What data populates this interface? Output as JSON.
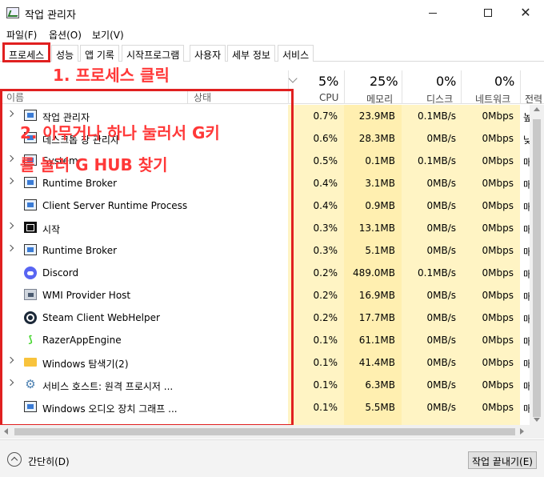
{
  "window": {
    "title": "작업 관리자"
  },
  "menu": [
    "파일(F)",
    "옵션(O)",
    "보기(V)"
  ],
  "tabs": [
    "프로세스",
    "성능",
    "앱 기록",
    "시작프로그램",
    "사용자",
    "세부 정보",
    "서비스"
  ],
  "annotations": {
    "step1": "1. 프로세스 클릭",
    "step2_line1": "2. 아무거나 하나 눌러서 G키",
    "step2_line2": "를 눌러 G HUB 찾기"
  },
  "columns": {
    "name": "이름",
    "status": "상태",
    "cpu": {
      "pct": "5%",
      "label": "CPU"
    },
    "memory": {
      "pct": "25%",
      "label": "메모리"
    },
    "disk": {
      "pct": "0%",
      "label": "디스크"
    },
    "network": {
      "pct": "0%",
      "label": "네트워크"
    },
    "power": {
      "label": "전력"
    }
  },
  "processes": [
    {
      "name": "작업 관리자",
      "expandable": true,
      "icon": "task-manager-icon",
      "cpu": "0.7%",
      "memory": "23.9MB",
      "disk": "0.1MB/s",
      "network": "0Mbps",
      "power": "높"
    },
    {
      "name": "데스크톱 창 관리자",
      "expandable": false,
      "icon": "window-icon",
      "cpu": "0.6%",
      "memory": "28.3MB",
      "disk": "0MB/s",
      "network": "0Mbps",
      "power": "낮"
    },
    {
      "name": "System",
      "expandable": true,
      "icon": "window-icon",
      "cpu": "0.5%",
      "memory": "0.1MB",
      "disk": "0.1MB/s",
      "network": "0Mbps",
      "power": "매"
    },
    {
      "name": "Runtime Broker",
      "expandable": true,
      "icon": "window-icon",
      "cpu": "0.4%",
      "memory": "3.1MB",
      "disk": "0MB/s",
      "network": "0Mbps",
      "power": "매"
    },
    {
      "name": "Client Server Runtime Process",
      "expandable": false,
      "icon": "window-icon",
      "cpu": "0.4%",
      "memory": "0.9MB",
      "disk": "0MB/s",
      "network": "0Mbps",
      "power": "매"
    },
    {
      "name": "시작",
      "expandable": true,
      "icon": "start-icon",
      "cpu": "0.3%",
      "memory": "13.1MB",
      "disk": "0MB/s",
      "network": "0Mbps",
      "power": "매"
    },
    {
      "name": "Runtime Broker",
      "expandable": true,
      "icon": "window-icon",
      "cpu": "0.3%",
      "memory": "5.1MB",
      "disk": "0MB/s",
      "network": "0Mbps",
      "power": "매"
    },
    {
      "name": "Discord",
      "expandable": false,
      "icon": "discord-icon",
      "cpu": "0.2%",
      "memory": "489.0MB",
      "disk": "0.1MB/s",
      "network": "0Mbps",
      "power": "매"
    },
    {
      "name": "WMI Provider Host",
      "expandable": false,
      "icon": "wmi-icon",
      "cpu": "0.2%",
      "memory": "16.9MB",
      "disk": "0MB/s",
      "network": "0Mbps",
      "power": "매"
    },
    {
      "name": "Steam Client WebHelper",
      "expandable": false,
      "icon": "steam-icon",
      "cpu": "0.2%",
      "memory": "17.7MB",
      "disk": "0MB/s",
      "network": "0Mbps",
      "power": "매"
    },
    {
      "name": "RazerAppEngine",
      "expandable": false,
      "icon": "razer-icon",
      "cpu": "0.1%",
      "memory": "61.1MB",
      "disk": "0MB/s",
      "network": "0Mbps",
      "power": "매"
    },
    {
      "name": "Windows 탐색기(2)",
      "expandable": true,
      "icon": "folder-icon",
      "cpu": "0.1%",
      "memory": "41.4MB",
      "disk": "0MB/s",
      "network": "0Mbps",
      "power": "매"
    },
    {
      "name": "서비스 호스트: 원격 프로시저 ...",
      "expandable": true,
      "icon": "gear-icon",
      "cpu": "0.1%",
      "memory": "6.3MB",
      "disk": "0MB/s",
      "network": "0Mbps",
      "power": "매"
    },
    {
      "name": "Windows 오디오 장치 그래프 ...",
      "expandable": false,
      "icon": "window-icon",
      "cpu": "0.1%",
      "memory": "5.5MB",
      "disk": "0MB/s",
      "network": "0Mbps",
      "power": "매"
    }
  ],
  "footer": {
    "collapse_label": "간단히(D)",
    "end_task_label": "작업 끝내기(E)"
  },
  "colors": {
    "highlight_red": "#e02020",
    "annotation_red": "#ff3838",
    "column_yellow": "#fff4c4"
  }
}
